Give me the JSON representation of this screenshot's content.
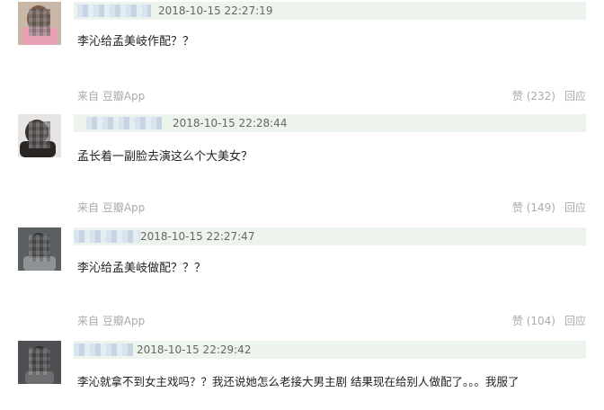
{
  "comments": [
    {
      "timestamp": "2018-10-15 22:27:19",
      "text": "李沁给孟美岐作配？？",
      "source": "来自 豆瓣App",
      "like": "赞 (232)",
      "reply": "回应",
      "avatar_bg": "#c9b8a8",
      "avatar_face": "#7a5a4a"
    },
    {
      "timestamp": "2018-10-15 22:28:44",
      "text": "孟长着一副脸去演这么个大美女？",
      "source": "来自 豆瓣App",
      "like": "赞 (149)",
      "reply": "回应",
      "avatar_bg": "#e7e5e3",
      "avatar_face": "#3c3430"
    },
    {
      "timestamp": "2018-10-15 22:27:47",
      "text": "李沁给孟美岐做配？？？",
      "source": "来自 豆瓣App",
      "like": "赞 (104)",
      "reply": "回应",
      "avatar_bg": "#5a5f62",
      "avatar_face": "#2e3234"
    },
    {
      "timestamp": "2018-10-15 22:29:42",
      "text": "李沁就拿不到女主戏吗？？我还说她怎么老接大男主剧 结果现在给别人做配了。。。我服了",
      "source": "",
      "like": "",
      "reply": "",
      "avatar_bg": "#4d4f52",
      "avatar_face": "#2b2c2e"
    }
  ]
}
